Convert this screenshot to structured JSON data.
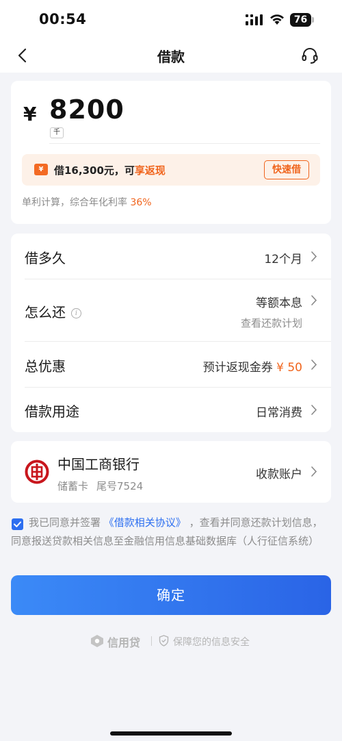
{
  "status_bar": {
    "time": "00:54",
    "battery": "76"
  },
  "nav": {
    "title": "借款",
    "back_icon": "chevron-left-icon",
    "service_icon": "headset-icon"
  },
  "amount": {
    "currency": "¥",
    "value": "8200",
    "unit": "千",
    "promo_icon_label": "¥",
    "promo_prefix": "借16,300元，可",
    "promo_highlight": "享返现",
    "quick_button": "快速借",
    "rate_prefix": "单利计算，综合年化利率 ",
    "rate_value": "36%"
  },
  "options": {
    "term": {
      "label": "借多久",
      "value": "12个月"
    },
    "repay": {
      "label": "怎么还",
      "info_icon": "i",
      "value": "等额本息",
      "sub": "查看还款计划"
    },
    "discount": {
      "label": "总优惠",
      "value_prefix": "预计返现金券 ",
      "value_amount": "¥ 50"
    },
    "purpose": {
      "label": "借款用途",
      "value": "日常消费"
    }
  },
  "bank": {
    "name": "中国工商银行",
    "card_type": "储蓄卡",
    "tail": "尾号7524",
    "action": "收款账户"
  },
  "agreement": {
    "checked": true,
    "prefix": "我已同意并签署 ",
    "link": "《借款相关协议》",
    "suffix": " ，查看并同意还款计划信息，同意报送贷款相关信息至金融信用信息基础数据库（人行征信系统）"
  },
  "confirm_button": "确定",
  "footer": {
    "brand": "信用贷",
    "safety": "保障您的信息安全"
  },
  "colors": {
    "accent": "#2d6ff0",
    "highlight": "#f0641c",
    "background": "#f3f4f8"
  }
}
